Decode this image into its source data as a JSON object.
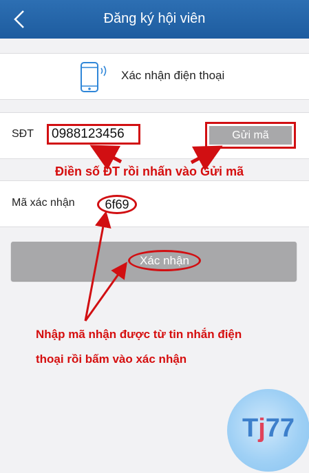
{
  "header": {
    "title": "Đăng ký hội viên",
    "back_icon": "chevron-left-icon"
  },
  "verify_section": {
    "icon": "phone-icon",
    "label": "Xác nhận điện thoại"
  },
  "phone_row": {
    "label": "SĐT",
    "value": "0988123456",
    "send_button_label": "Gửi mã"
  },
  "annotation_top": "Điền số ĐT rồi nhấn vào Gửi mã",
  "code_row": {
    "label": "Mã xác nhận",
    "value": "6f69"
  },
  "confirm_button_label": "Xác nhận",
  "annotation_bottom": {
    "line1": "Nhập mã nhận được từ tin nhắn điện",
    "line2": "thoại rồi bấm vào xác nhận"
  },
  "watermark": {
    "part1": "T",
    "part2": "j",
    "part3": "77"
  },
  "colors": {
    "header": "#2269ad",
    "annotation": "#d10f12",
    "button": "#a8a8aa",
    "background": "#f2f2f4"
  }
}
